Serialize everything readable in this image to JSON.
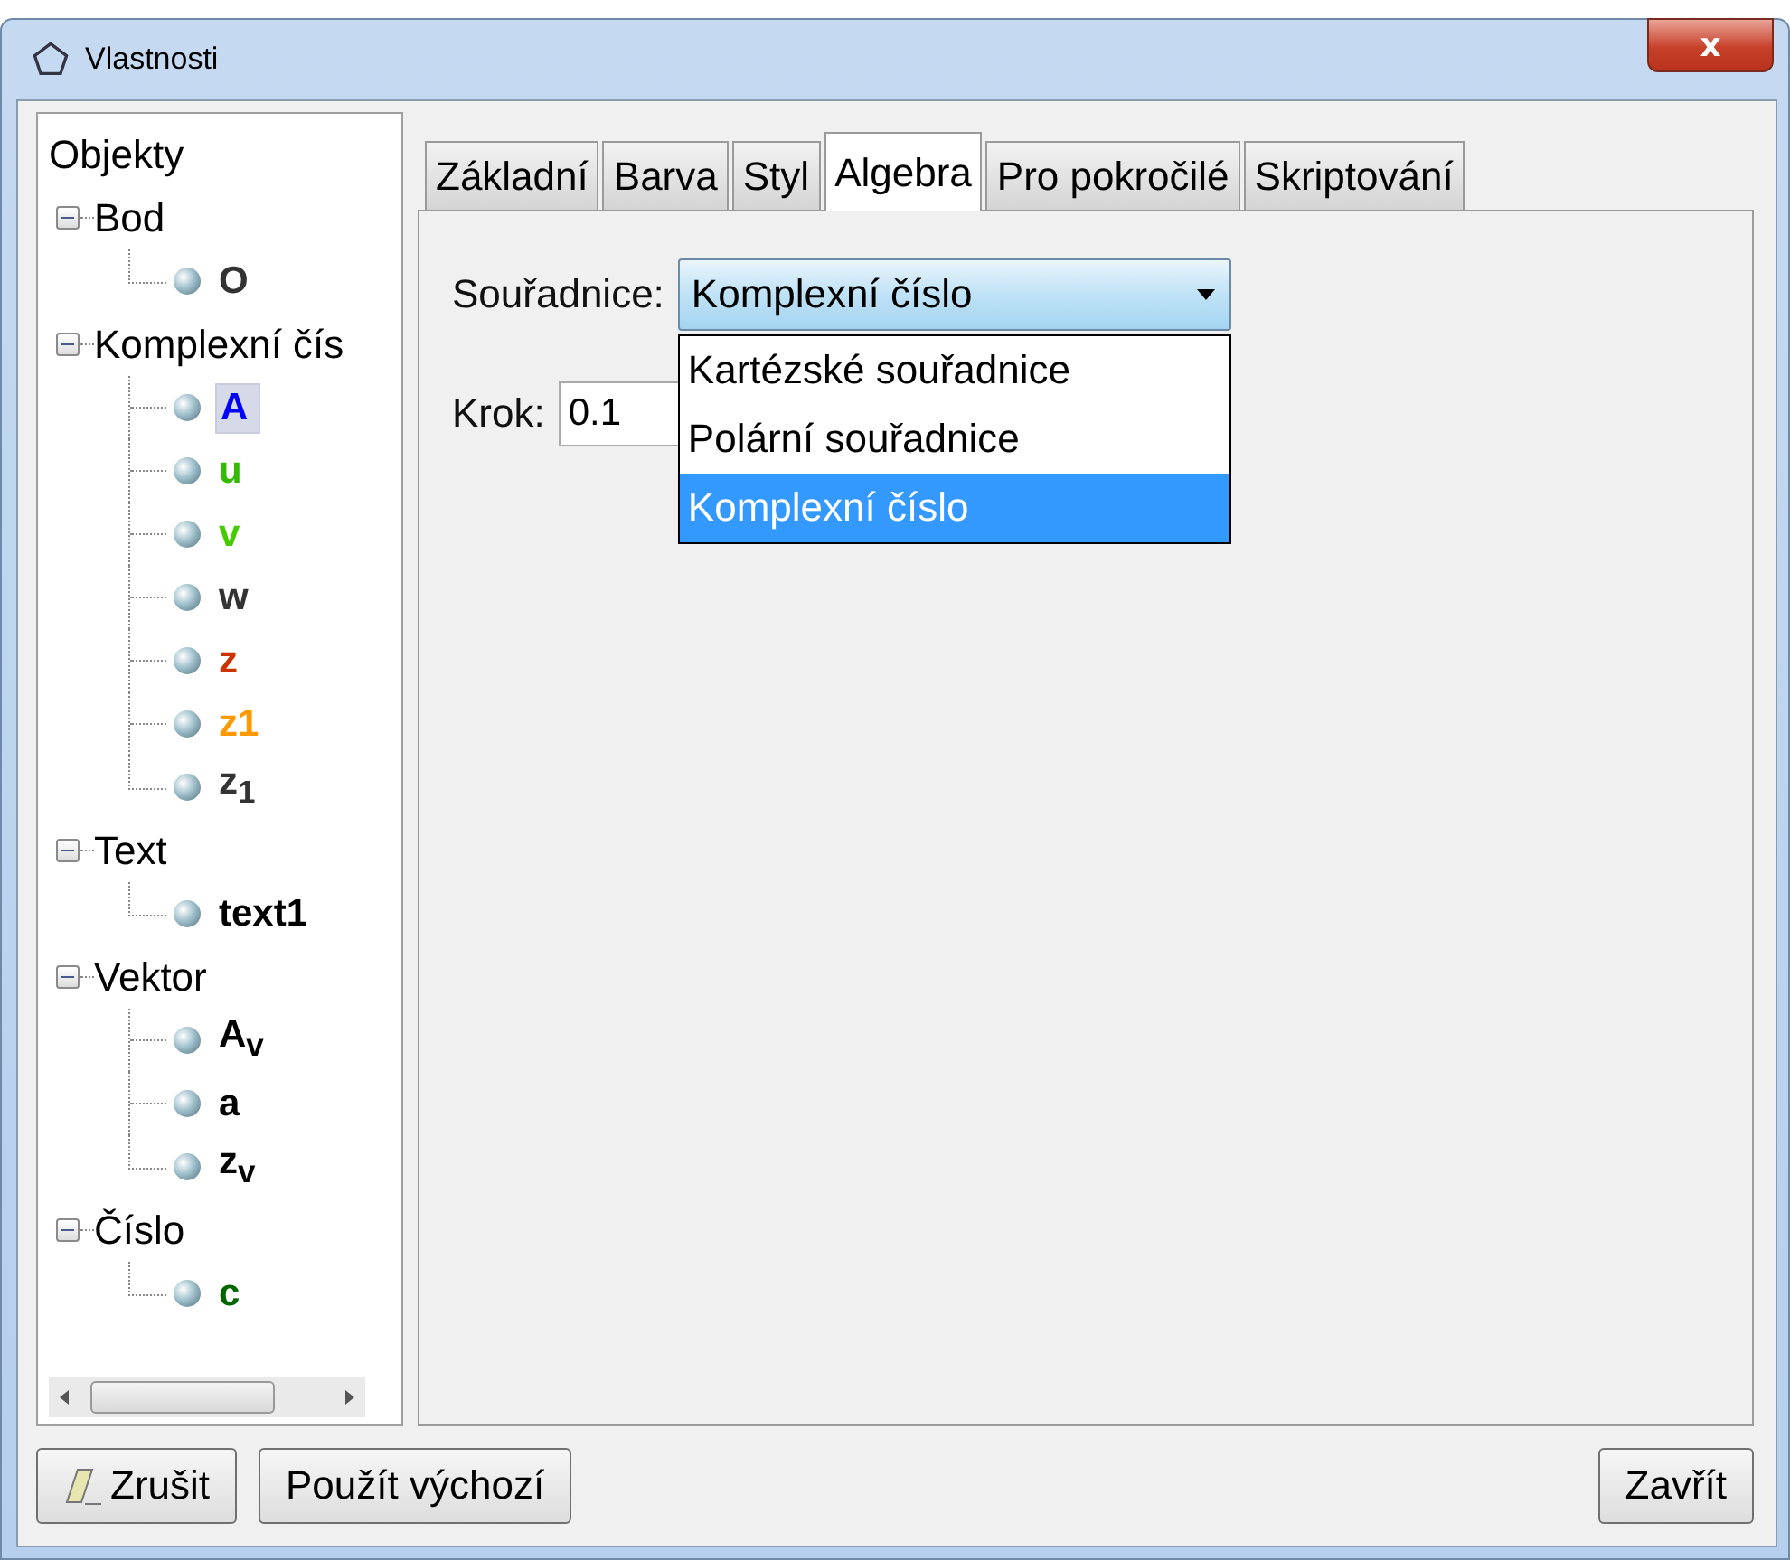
{
  "window": {
    "title": "Vlastnosti",
    "close": "x"
  },
  "tree": {
    "root": "Objekty",
    "groups": [
      {
        "label": "Bod",
        "expanded": true,
        "children": [
          {
            "label": "O",
            "color": "#333333",
            "selected": false
          }
        ]
      },
      {
        "label": "Komplexní čís",
        "expanded": true,
        "children": [
          {
            "label": "A",
            "color": "#0000ff",
            "selected": true
          },
          {
            "label": "u",
            "color": "#33bb00",
            "selected": false
          },
          {
            "label": "v",
            "color": "#44cc00",
            "selected": false
          },
          {
            "label": "w",
            "color": "#333333",
            "selected": false
          },
          {
            "label": "z",
            "color": "#cc3300",
            "selected": false
          },
          {
            "label": "z1",
            "color": "#ff9900",
            "selected": false
          },
          {
            "label": "z$_{1}$",
            "color": "#333333",
            "selected": false
          }
        ]
      },
      {
        "label": "Text",
        "expanded": true,
        "children": [
          {
            "label": "text1",
            "color": "#000000",
            "selected": false
          }
        ]
      },
      {
        "label": "Vektor",
        "expanded": true,
        "children": [
          {
            "label": "A$_{v}$",
            "color": "#000000",
            "selected": false
          },
          {
            "label": "a",
            "color": "#000000",
            "selected": false
          },
          {
            "label": "z$_{v}$",
            "color": "#000000",
            "selected": false
          }
        ]
      },
      {
        "label": "Číslo",
        "expanded": true,
        "children": [
          {
            "label": "c",
            "color": "#006600",
            "selected": false
          }
        ]
      }
    ]
  },
  "tabs": [
    {
      "label": "Základní",
      "selected": false
    },
    {
      "label": "Barva",
      "selected": false
    },
    {
      "label": "Styl",
      "selected": false
    },
    {
      "label": "Algebra",
      "selected": true
    },
    {
      "label": "Pro pokročilé",
      "selected": false
    },
    {
      "label": "Skriptování",
      "selected": false
    }
  ],
  "coords": {
    "label": "Souřadnice:",
    "value": "Komplexní číslo",
    "options": [
      {
        "label": "Kartézské souřadnice",
        "selected": false
      },
      {
        "label": "Polární souřadnice",
        "selected": false
      },
      {
        "label": "Komplexní číslo",
        "selected": true
      }
    ]
  },
  "step": {
    "label": "Krok:",
    "value": "0.1"
  },
  "buttons": [
    {
      "label": "Zrušit",
      "kind": "eraser"
    },
    {
      "label": "Použít výchozí",
      "kind": "plain"
    },
    {
      "label": "Zavřít",
      "kind": "plain"
    }
  ]
}
